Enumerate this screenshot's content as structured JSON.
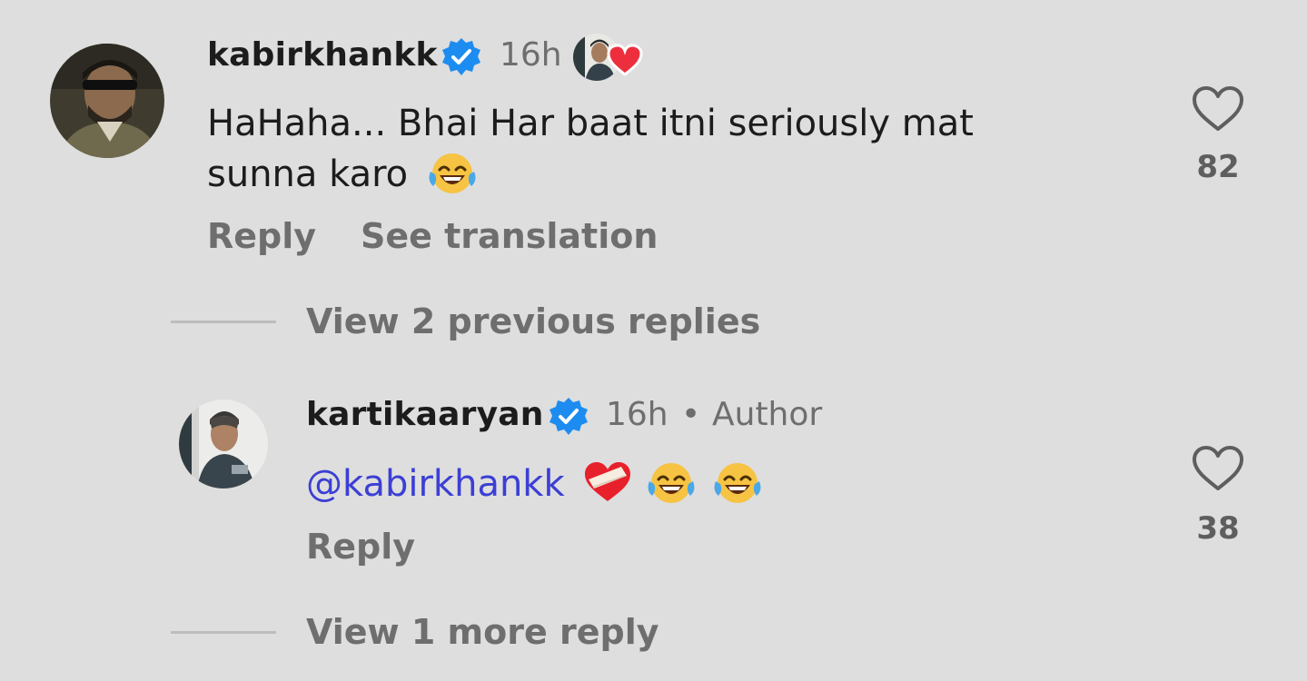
{
  "comments": [
    {
      "username": "kabirkhankk",
      "verified": true,
      "time": "16h",
      "liked_by_author": true,
      "text_line1": "HaHaha... Bhai Har baat itni seriously mat",
      "text_line2": "sunna karo",
      "text_emojis": [
        "joy-emoji"
      ],
      "likes": "82",
      "actions": {
        "reply": "Reply",
        "translate": "See translation"
      }
    }
  ],
  "view_previous": "View 2 previous replies",
  "reply": {
    "username": "kartikaaryan",
    "verified": true,
    "time": "16h",
    "separator": "•",
    "author_badge": "Author",
    "mention": "@kabirkhankk",
    "emojis": [
      "mending-heart-emoji",
      "joy-emoji",
      "joy-emoji"
    ],
    "likes": "38",
    "reply_label": "Reply"
  },
  "view_more": "View 1 more reply",
  "colors": {
    "background": "#dedede",
    "verified": "#1d8cf0",
    "mention": "#3b3fd4",
    "heart": "#ed2f3d"
  }
}
